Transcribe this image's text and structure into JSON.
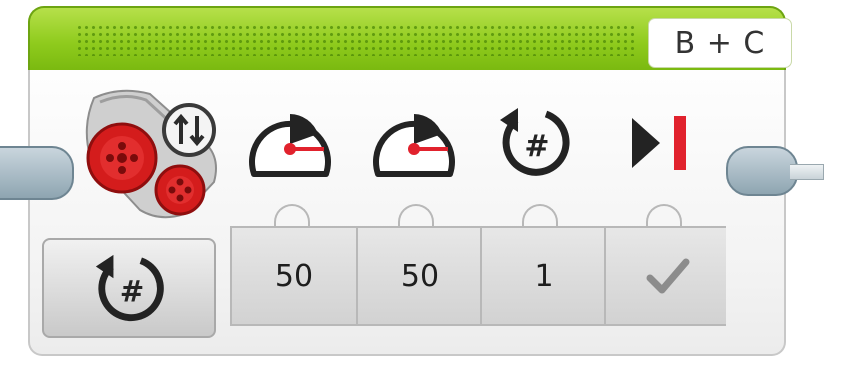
{
  "block": {
    "type": "move-tank",
    "port_label": "B + C",
    "mode": "rotations-icon",
    "params": [
      {
        "icon": "power-left-gauge-icon",
        "value": "50"
      },
      {
        "icon": "power-right-gauge-icon",
        "value": "50"
      },
      {
        "icon": "rotations-icon",
        "value": "1"
      },
      {
        "icon": "brake-at-end-icon",
        "value": "✓"
      }
    ]
  },
  "colors": {
    "header_green": "#8fcb1d",
    "accent_red": "#e1222d",
    "connector_blue_gray": "#8ea5b1"
  }
}
